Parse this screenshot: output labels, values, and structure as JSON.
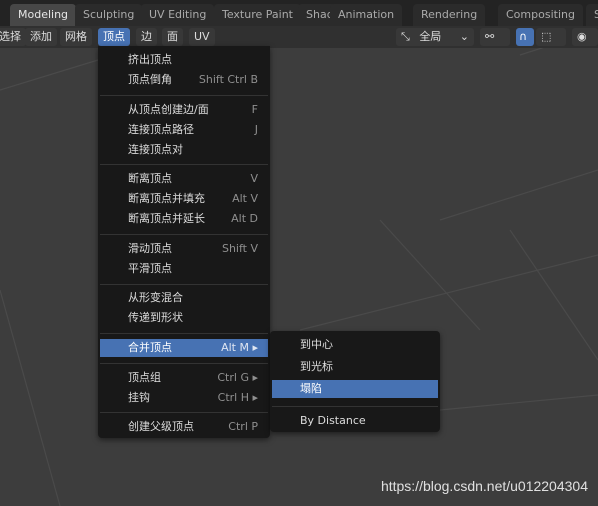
{
  "workspace_tabs": [
    "Modeling",
    "Sculpting",
    "UV Editing",
    "Texture Paint",
    "Shading",
    "Animation",
    "Rendering",
    "Compositing",
    "Sc"
  ],
  "active_tab": "Modeling",
  "header_menus": [
    "选择",
    "添加",
    "网格",
    "顶点",
    "边",
    "面",
    "UV"
  ],
  "active_menu": "顶点",
  "transform_orientation": "全局",
  "vertex_menu": [
    {
      "label": "挤出顶点",
      "shortcut": ""
    },
    {
      "label": "顶点倒角",
      "shortcut": "Shift Ctrl B"
    },
    {
      "separator": true
    },
    {
      "label": "从顶点创建边/面",
      "shortcut": "F"
    },
    {
      "label": "连接顶点路径",
      "shortcut": "J"
    },
    {
      "label": "连接顶点对",
      "shortcut": ""
    },
    {
      "separator": true
    },
    {
      "label": "断离顶点",
      "shortcut": "V"
    },
    {
      "label": "断离顶点并填充",
      "shortcut": "Alt V"
    },
    {
      "label": "断离顶点并延长",
      "shortcut": "Alt D"
    },
    {
      "separator": true
    },
    {
      "label": "滑动顶点",
      "shortcut": "Shift V"
    },
    {
      "label": "平滑顶点",
      "shortcut": ""
    },
    {
      "separator": true
    },
    {
      "label": "从形变混合",
      "shortcut": ""
    },
    {
      "label": "传递到形状",
      "shortcut": ""
    },
    {
      "separator": true
    },
    {
      "label": "合并顶点",
      "shortcut": "Alt M ▸",
      "highlighted": true
    },
    {
      "separator": true
    },
    {
      "label": "顶点组",
      "shortcut": "Ctrl G ▸"
    },
    {
      "label": "挂钩",
      "shortcut": "Ctrl H ▸"
    },
    {
      "separator": true
    },
    {
      "label": "创建父级顶点",
      "shortcut": "Ctrl P"
    }
  ],
  "merge_submenu": [
    {
      "label": "到中心"
    },
    {
      "label": "到光标"
    },
    {
      "label": "塌陷",
      "highlighted": true
    },
    {
      "separator": true
    },
    {
      "label": "By Distance"
    }
  ],
  "watermark": "https://blog.csdn.net/u012204304",
  "colors": {
    "accent": "#4772b3",
    "menu_bg": "#181818",
    "viewport": "#3d3d3d"
  }
}
